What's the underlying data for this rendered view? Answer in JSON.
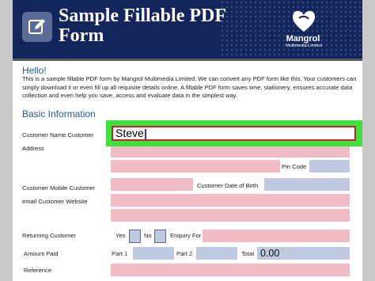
{
  "header": {
    "title": "Sample Fillable PDF Form",
    "logo_name": "Mangrol",
    "logo_sub": "Multimedia Limited"
  },
  "intro": {
    "greeting": "Hello!",
    "text": "This is a sample fillable PDF form by Mangrol Multimedia Limited. We can convert any PDF form like this. Your customers can simply download it or even fill up all requisite details online. A fillable PDF form saves time, stationery, ensures accurate data collection and even help you save, access and evaluate data in the simplest way."
  },
  "basic_info": {
    "heading": "Basic Information",
    "customer_name_label": "Customer Name Customer",
    "customer_name_value": "Steve",
    "address_label": "Address",
    "pin_code_label": "Pin Code",
    "mobile_label": "Customer Mobile  Customer",
    "dob_label": "Customer Date of Birth",
    "email_label": "email Customer Website",
    "returning_label": "Returning Customer",
    "yes_label": "Yes",
    "no_label": "No",
    "enquiry_label": "Enquiry For",
    "amount_label": "Amount Paid",
    "part1_label": "Part 1",
    "part2_label": "Part 2",
    "total_label": "Total",
    "total_value": "0.00",
    "reference_label": "Reference"
  },
  "colors": {
    "banner": "#13255a",
    "field_pink": "#f2bcc6",
    "field_blue": "#bfc9e0",
    "focus_green": "#3fe23a",
    "input_border_red": "#d21b2b",
    "heading_blue": "#1f5b96"
  },
  "icons": [
    "edit-icon",
    "heart-logo-icon"
  ]
}
